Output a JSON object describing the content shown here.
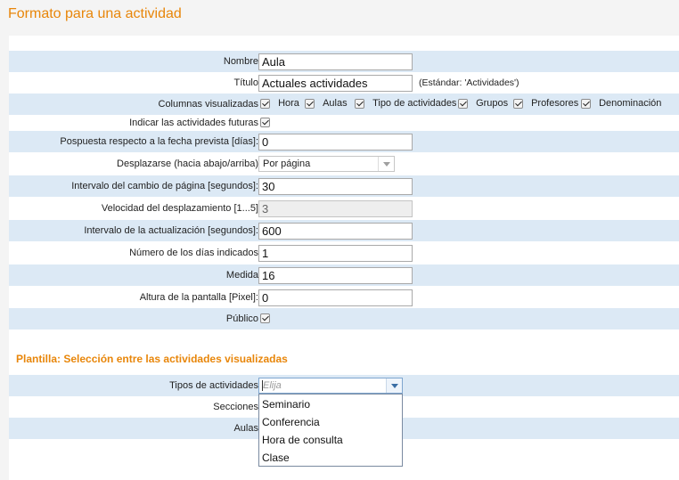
{
  "header": {
    "title": "Formato para una actividad"
  },
  "form": {
    "nombre": {
      "label": "Nombre",
      "value": "Aula"
    },
    "titulo": {
      "label": "Título",
      "value": "Actuales actividades",
      "hint": "(Estándar: 'Actividades')"
    },
    "columnas": {
      "label": "Columnas visualizadas",
      "items": [
        {
          "label": "Hora",
          "checked": true
        },
        {
          "label": "Aulas",
          "checked": true
        },
        {
          "label": "Tipo de actividades",
          "checked": true
        },
        {
          "label": "Grupos",
          "checked": true
        },
        {
          "label": "Profesores",
          "checked": true
        },
        {
          "label": "Denominación",
          "checked": true
        }
      ]
    },
    "futuras": {
      "label": "Indicar las actividades futuras",
      "checked": true
    },
    "pospuesta": {
      "label": "Pospuesta respecto a la fecha prevista [días]:",
      "value": "0"
    },
    "desplazarse": {
      "label": "Desplazarse (hacia abajo/arriba)",
      "value": "Por página"
    },
    "intervalo_pagina": {
      "label": "Intervalo del cambio de página [segundos]:",
      "value": "30"
    },
    "velocidad": {
      "label": "Velocidad del desplazamiento [1...5]",
      "value": "3"
    },
    "intervalo_actualizacion": {
      "label": "Intervalo de la actualización [segundos]:",
      "value": "600"
    },
    "numero_dias": {
      "label": "Número de los días indicados",
      "value": "1"
    },
    "medida": {
      "label": "Medida",
      "value": "16"
    },
    "altura": {
      "label": "Altura de la pantalla [Pixel]:",
      "value": "0"
    },
    "publico": {
      "label": "Público",
      "checked": true
    }
  },
  "template_section": {
    "title": "Plantilla: Selección entre las actividades visualizadas",
    "tipos": {
      "label": "Tipos de actividades",
      "placeholder": "Elija"
    },
    "secciones": {
      "label": "Secciones"
    },
    "aulas": {
      "label": "Aulas"
    },
    "dropdown_options": [
      "Seminario",
      "Conferencia",
      "Hora de consulta",
      "Clase"
    ]
  },
  "colors": {
    "accent": "#e8860a",
    "row_alt": "#dce9f5",
    "header_bg": "#f4f4f4"
  }
}
